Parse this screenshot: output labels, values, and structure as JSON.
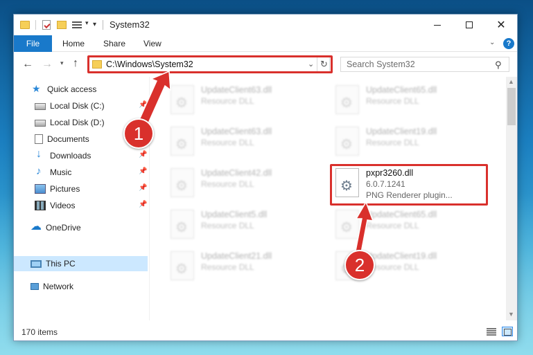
{
  "window": {
    "title": "System32",
    "controls": {
      "minimize": "—",
      "maximize": "☐",
      "close": "✕"
    }
  },
  "ribbon": {
    "tabs": [
      {
        "label": "File"
      },
      {
        "label": "Home"
      },
      {
        "label": "Share"
      },
      {
        "label": "View"
      }
    ],
    "help": "?"
  },
  "address": {
    "path": "C:\\Windows\\System32",
    "search_placeholder": "Search System32"
  },
  "sidebar": {
    "items": [
      {
        "label": "Quick access",
        "icon": "star-icon",
        "pinned": false
      },
      {
        "label": "Local Disk (C:)",
        "icon": "disk-icon",
        "pinned": true
      },
      {
        "label": "Local Disk (D:)",
        "icon": "disk-icon",
        "pinned": false
      },
      {
        "label": "Documents",
        "icon": "documents-icon",
        "pinned": true
      },
      {
        "label": "Downloads",
        "icon": "downloads-icon",
        "pinned": true
      },
      {
        "label": "Music",
        "icon": "music-icon",
        "pinned": true
      },
      {
        "label": "Pictures",
        "icon": "pictures-icon",
        "pinned": true
      },
      {
        "label": "Videos",
        "icon": "videos-icon",
        "pinned": true
      },
      {
        "label": "OneDrive",
        "icon": "onedrive-icon",
        "pinned": false
      },
      {
        "label": "This PC",
        "icon": "pc-icon",
        "pinned": false,
        "selected": true
      },
      {
        "label": "Network",
        "icon": "network-icon",
        "pinned": false
      }
    ]
  },
  "files": [
    {
      "name": "UpdateClient63.dll",
      "type": "Resource DLL"
    },
    {
      "name": "UpdateClient65.dll",
      "type": "Resource DLL"
    },
    {
      "name": "UpdateClient63.dll",
      "type": "Resource DLL"
    },
    {
      "name": "UpdateClient19.dll",
      "type": "Resource DLL"
    },
    {
      "name": "UpdateClient42.dll",
      "type": "Resource DLL"
    },
    {
      "name": "pxpr3260.dll",
      "version": "6.0.7.1241",
      "description": "PNG Renderer plugin..."
    },
    {
      "name": "UpdateClient5.dll",
      "type": "Resource DLL"
    },
    {
      "name": "UpdateClient65.dll",
      "type": "Resource DLL"
    },
    {
      "name": "UpdateClient21.dll",
      "type": "Resource DLL"
    },
    {
      "name": "UpdateClient19.dll",
      "type": "Resource DLL"
    }
  ],
  "status": {
    "item_count": "170 items"
  },
  "callouts": [
    {
      "number": "1"
    },
    {
      "number": "2"
    }
  ],
  "colors": {
    "accent": "#1979ca",
    "highlight": "#d9302c",
    "selected": "#cce8ff"
  }
}
